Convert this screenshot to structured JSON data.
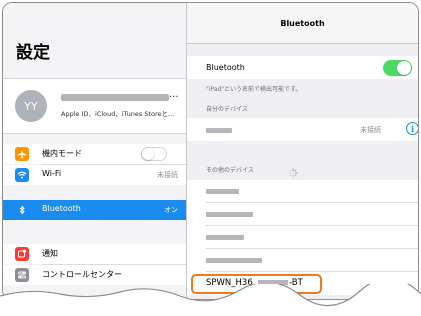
{
  "sidebar": {
    "title": "設定",
    "profile": {
      "initials": "YY",
      "name_suffix": "...",
      "subtitle": "Apple ID、iCloud、iTunes Storeと..."
    },
    "items": [
      {
        "label": "機内モード",
        "icon": "airplane-icon",
        "color": "#ff9500"
      },
      {
        "label": "Wi-Fi",
        "value": "未接続",
        "icon": "wifi-icon",
        "color": "#1a8cf0"
      },
      {
        "label": "Bluetooth",
        "value": "オン",
        "icon": "bluetooth-icon",
        "color": "#1a8cf0"
      },
      {
        "label": "通知",
        "icon": "notification-icon",
        "color": "#ff3b30"
      },
      {
        "label": "コントロールセンター",
        "icon": "control-center-icon",
        "color": "#8e8e93"
      }
    ]
  },
  "detail": {
    "title": "Bluetooth",
    "bluetooth_label": "Bluetooth",
    "bluetooth_on": true,
    "discoverable_note": "\"iPad\"という名前で検出可能です。",
    "my_devices_header": "自分のデバイス",
    "my_device_status": "未接続",
    "other_devices_header": "その他のデバイス",
    "highlighted_device": "SPWN_H36_",
    "highlighted_device_suffix": "-BT"
  },
  "colors": {
    "accent": "#1a8cf0",
    "toggle_on": "#4cd964",
    "highlight": "#ef7b1e"
  }
}
